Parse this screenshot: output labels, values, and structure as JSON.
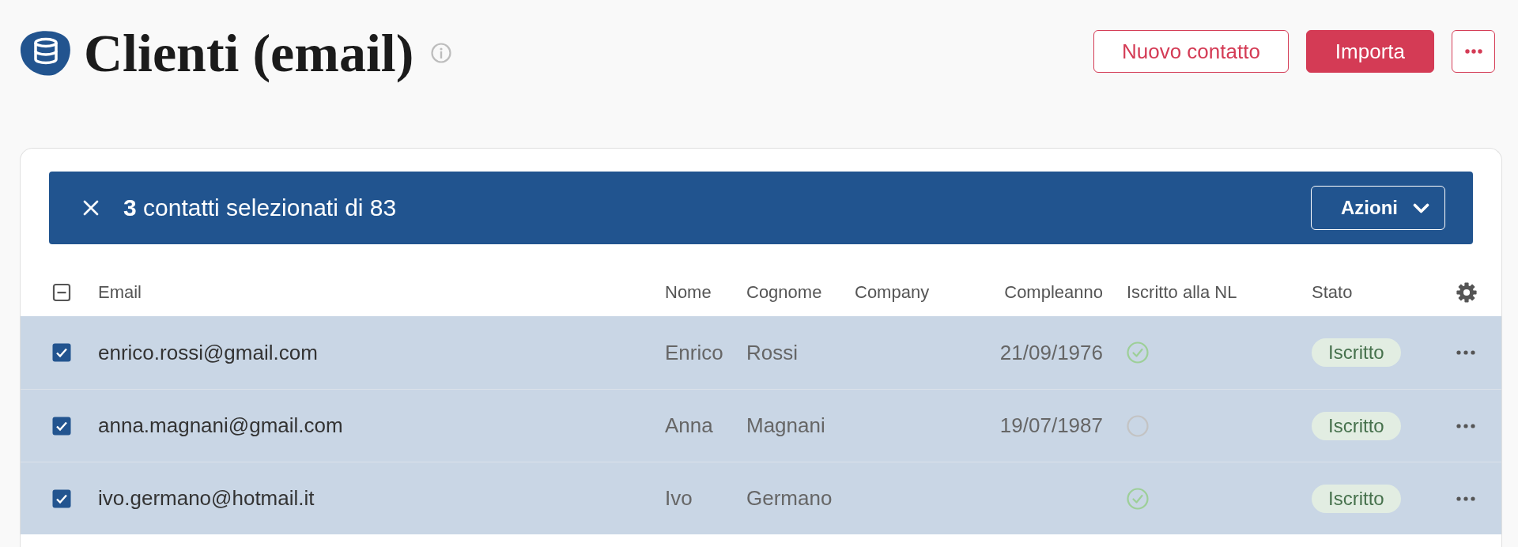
{
  "header": {
    "title": "Clienti (email)",
    "buttons": [
      {
        "kind": "outline",
        "label": "Nuovo contatto"
      },
      {
        "kind": "primary",
        "label": "Importa"
      },
      {
        "kind": "more"
      }
    ]
  },
  "selection_bar": {
    "summary": "**3** contatti selezionati di 83",
    "button": "Azioni"
  },
  "table": {
    "select_all": {
      "checked": false,
      "indeterminate": true
    },
    "columns": [
      {
        "label": "Email"
      },
      {
        "label": "Nome"
      },
      {
        "label": "Cognome"
      },
      {
        "label": "Company"
      },
      {
        "label": "Compleanno"
      },
      {
        "label": "Iscritto alla NL"
      },
      {
        "label": "Stato"
      }
    ],
    "rows": [
      {
        "selected": true,
        "email": "enrico.rossi@gmail.com",
        "nome": "Enrico",
        "cognome": "Rossi",
        "compleanno": "21/09/1976",
        "newsletter": true,
        "stato": "Iscritto"
      },
      {
        "selected": true,
        "email": "anna.magnani@gmail.com",
        "nome": "Anna",
        "cognome": "Magnani",
        "compleanno": "19/07/1987",
        "newsletter": false,
        "stato": "Iscritto"
      },
      {
        "selected": true,
        "email": "ivo.germano@hotmail.it",
        "nome": "Ivo",
        "cognome": "Germano",
        "newsletter": true,
        "stato": "Iscritto"
      }
    ]
  }
}
